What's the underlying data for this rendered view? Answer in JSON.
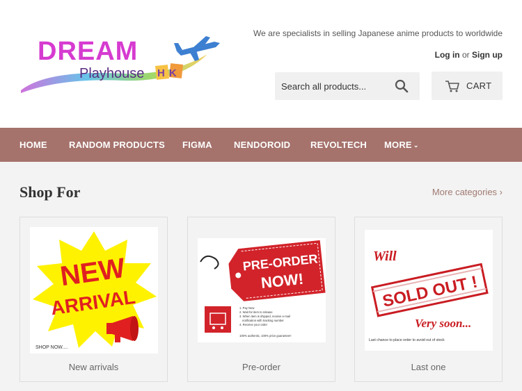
{
  "header": {
    "logo": {
      "line1": "DREAM",
      "line2": "Playhouse",
      "line3": "HK"
    },
    "tagline": "We are specialists in selling Japanese anime products to worldwide",
    "account": {
      "login": "Log in",
      "or": "or",
      "signup": "Sign up"
    },
    "search": {
      "placeholder": "Search all products...",
      "icon": "search-icon"
    },
    "cart": {
      "label": "CART",
      "icon": "cart-icon"
    }
  },
  "nav": {
    "items": [
      {
        "label": "HOME"
      },
      {
        "label": "RANDOM PRODUCTS"
      },
      {
        "label": "FIGMA"
      },
      {
        "label": "NENDOROID"
      },
      {
        "label": "REVOLTECH"
      },
      {
        "label": "MORE",
        "icon": "chevron-down-icon"
      }
    ]
  },
  "main": {
    "title": "Shop For",
    "more_link": "More categories ›",
    "cards": [
      {
        "label": "New arrivals",
        "img_line1": "NEW",
        "img_line2": "ARRIVAL",
        "img_caption": "SHOP NOW...."
      },
      {
        "label": "Pre-order",
        "img_line1": "PRE-ORDER",
        "img_line2": "NOW!",
        "img_steps": [
          "1. Pay Now",
          "2. Wait for item to release",
          "3. When item is shipped, receive e-mail",
          "notification with tracking number",
          "4. Receive your order"
        ],
        "img_caption": "100% authentic, 100% price guarantee!!"
      },
      {
        "label": "Last one",
        "img_line1": "Will",
        "img_line2": "SOLD OUT !",
        "img_line3": "Very soon...",
        "img_caption": "Last chance to place order to avoid out of stock"
      }
    ]
  },
  "colors": {
    "nav_bg": "#a5726c",
    "accent_red": "#c91c22",
    "link": "#a07a72"
  }
}
